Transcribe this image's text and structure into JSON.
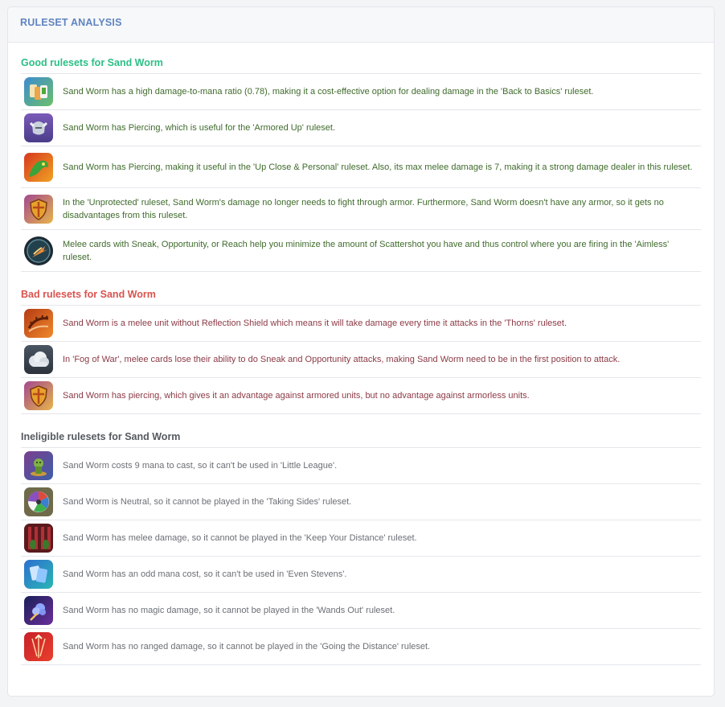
{
  "header": {
    "title": "RULESET ANALYSIS"
  },
  "colors": {
    "good": "#2bbf86",
    "bad": "#d9534f",
    "ineligible": "#555a60",
    "header": "#5f84c0"
  },
  "good": {
    "title": "Good rulesets for Sand Worm",
    "items": [
      {
        "icon": "back-to-basics-icon",
        "text": "Sand Worm has a high damage-to-mana ratio (0.78), making it a cost-effective option for dealing damage in the 'Back to Basics' ruleset."
      },
      {
        "icon": "armored-up-icon",
        "text": "Sand Worm has Piercing, which is useful for the 'Armored Up' ruleset."
      },
      {
        "icon": "up-close-personal-icon",
        "text": "Sand Worm has Piercing, making it useful in the 'Up Close & Personal' ruleset. Also, its max melee damage is 7, making it a strong damage dealer in this ruleset."
      },
      {
        "icon": "unprotected-icon",
        "text": "In the 'Unprotected' ruleset, Sand Worm's damage no longer needs to fight through armor. Furthermore, Sand Worm doesn't have any armor, so it gets no disadvantages from this ruleset."
      },
      {
        "icon": "aimless-icon",
        "text": "Melee cards with Sneak, Opportunity, or Reach help you minimize the amount of Scattershot you have and thus control where you are firing in the 'Aimless' ruleset."
      }
    ]
  },
  "bad": {
    "title": "Bad rulesets for Sand Worm",
    "items": [
      {
        "icon": "thorns-icon",
        "text": "Sand Worm is a melee unit without Reflection Shield which means it will take damage every time it attacks in the 'Thorns' ruleset."
      },
      {
        "icon": "fog-of-war-icon",
        "text": "In 'Fog of War', melee cards lose their ability to do Sneak and Opportunity attacks, making Sand Worm need to be in the first position to attack."
      },
      {
        "icon": "unprotected-icon",
        "text": "Sand Worm has piercing, which gives it an advantage against armored units, but no advantage against armorless units."
      }
    ]
  },
  "ineligible": {
    "title": "Ineligible rulesets for Sand Worm",
    "items": [
      {
        "icon": "little-league-icon",
        "text": "Sand Worm costs 9 mana to cast, so it can't be used in 'Little League'."
      },
      {
        "icon": "taking-sides-icon",
        "text": "Sand Worm is Neutral, so it cannot be played in the 'Taking Sides' ruleset."
      },
      {
        "icon": "keep-your-distance-icon",
        "text": "Sand Worm has melee damage, so it cannot be played in the 'Keep Your Distance' ruleset."
      },
      {
        "icon": "even-stevens-icon",
        "text": "Sand Worm has an odd mana cost, so it can't be used in 'Even Stevens'."
      },
      {
        "icon": "wands-out-icon",
        "text": "Sand Worm has no magic damage, so it cannot be played in the 'Wands Out' ruleset."
      },
      {
        "icon": "going-the-distance-icon",
        "text": "Sand Worm has no ranged damage, so it cannot be played in the 'Going the Distance' ruleset."
      }
    ]
  }
}
